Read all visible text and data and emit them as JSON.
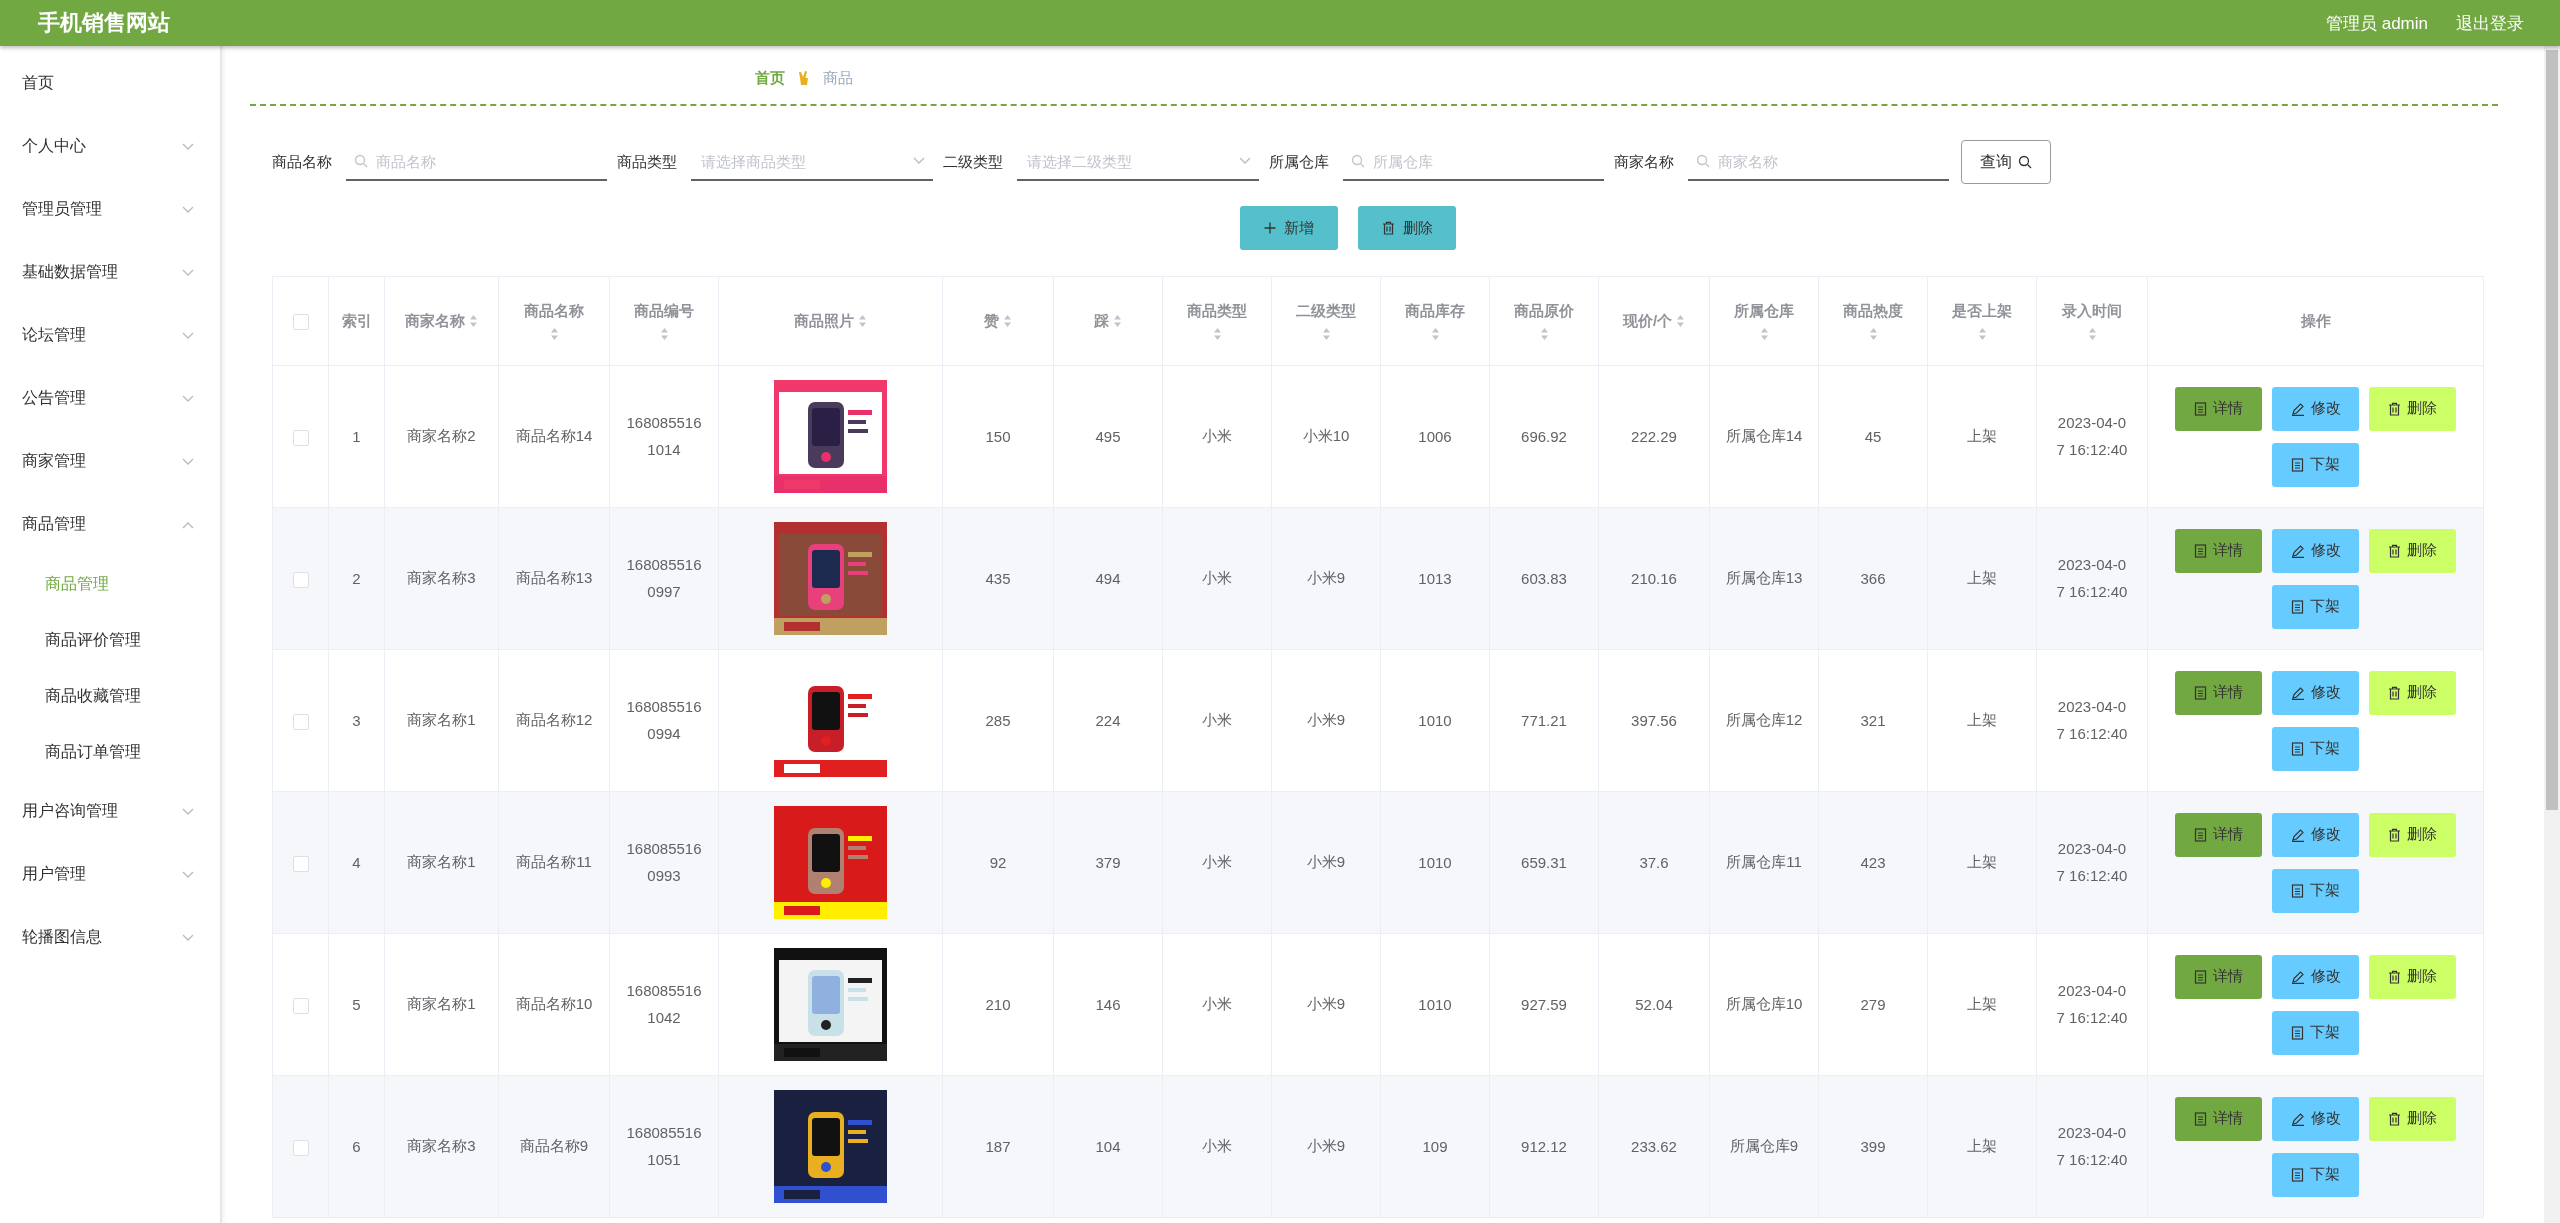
{
  "header": {
    "title": "手机销售网站",
    "user": "管理员 admin",
    "logout": "退出登录"
  },
  "sidebar": {
    "items": [
      {
        "label": "首页",
        "kind": "link"
      },
      {
        "label": "个人中心",
        "kind": "group",
        "expanded": false
      },
      {
        "label": "管理员管理",
        "kind": "group",
        "expanded": false
      },
      {
        "label": "基础数据管理",
        "kind": "group",
        "expanded": false
      },
      {
        "label": "论坛管理",
        "kind": "group",
        "expanded": false
      },
      {
        "label": "公告管理",
        "kind": "group",
        "expanded": false
      },
      {
        "label": "商家管理",
        "kind": "group",
        "expanded": false
      },
      {
        "label": "商品管理",
        "kind": "group",
        "expanded": true,
        "children": [
          {
            "label": "商品管理",
            "selected": true
          },
          {
            "label": "商品评价管理",
            "selected": false
          },
          {
            "label": "商品收藏管理",
            "selected": false
          },
          {
            "label": "商品订单管理",
            "selected": false
          }
        ]
      },
      {
        "label": "用户咨询管理",
        "kind": "group",
        "expanded": false
      },
      {
        "label": "用户管理",
        "kind": "group",
        "expanded": false
      },
      {
        "label": "轮播图信息",
        "kind": "group",
        "expanded": false
      }
    ]
  },
  "breadcrumb": [
    {
      "label": "首页",
      "selected": true
    },
    {
      "label": "商品",
      "selected": false
    }
  ],
  "search": {
    "fields": [
      {
        "label": "商品名称",
        "placeholder": "商品名称",
        "kind": "text"
      },
      {
        "label": "商品类型",
        "placeholder": "请选择商品类型",
        "kind": "select"
      },
      {
        "label": "二级类型",
        "placeholder": "请选择二级类型",
        "kind": "select"
      },
      {
        "label": "所属仓库",
        "placeholder": "所属仓库",
        "kind": "text"
      },
      {
        "label": "商家名称",
        "placeholder": "商家名称",
        "kind": "text"
      }
    ],
    "button": "查询"
  },
  "toolbar": [
    {
      "label": "新增",
      "kind": "add"
    },
    {
      "label": "删除",
      "kind": "delete"
    }
  ],
  "table": {
    "select_all": {
      "checked": false
    },
    "columns": [
      {
        "label": "索引",
        "kind": "plain"
      },
      {
        "label": "商家名称",
        "kind": "inline"
      },
      {
        "label": "商品名称",
        "kind": "stacked"
      },
      {
        "label": "商品编号",
        "kind": "stacked"
      },
      {
        "label": "商品照片",
        "kind": "inline"
      },
      {
        "label": "赞",
        "kind": "inline"
      },
      {
        "label": "踩",
        "kind": "inline"
      },
      {
        "label": "商品类型",
        "kind": "stacked"
      },
      {
        "label": "二级类型",
        "kind": "stacked"
      },
      {
        "label": "商品库存",
        "kind": "stacked"
      },
      {
        "label": "商品原价",
        "kind": "stacked"
      },
      {
        "label": "现价/个",
        "kind": "inline"
      },
      {
        "label": "所属仓库",
        "kind": "stacked"
      },
      {
        "label": "商品热度",
        "kind": "stacked"
      },
      {
        "label": "是否上架",
        "kind": "stacked"
      },
      {
        "label": "录入时间",
        "kind": "stacked"
      },
      {
        "label": "操作",
        "kind": "plain"
      }
    ],
    "rows": [
      {
        "checked": false,
        "cells": [
          "1",
          "商家名称2",
          "商品名称14",
          "1680855161014",
          {
            "kind": "picture"
          },
          "150",
          "495",
          "小米",
          "小米10",
          "1006",
          "696.92",
          "222.29",
          "所属仓库14",
          "45",
          "上架",
          "2023-04-07 16:12:40"
        ],
        "actions": [
          {
            "label": "详情",
            "kind": "detail"
          },
          {
            "label": "修改",
            "kind": "edit"
          },
          {
            "label": "删除",
            "kind": "delete"
          },
          {
            "label": "下架",
            "kind": "offshelf"
          }
        ]
      },
      {
        "checked": false,
        "cells": [
          "2",
          "商家名称3",
          "商品名称13",
          "1680855160997",
          {
            "kind": "picture"
          },
          "435",
          "494",
          "小米",
          "小米9",
          "1013",
          "603.83",
          "210.16",
          "所属仓库13",
          "366",
          "上架",
          "2023-04-07 16:12:40"
        ],
        "actions": [
          {
            "label": "详情",
            "kind": "detail"
          },
          {
            "label": "修改",
            "kind": "edit"
          },
          {
            "label": "删除",
            "kind": "delete"
          },
          {
            "label": "下架",
            "kind": "offshelf"
          }
        ]
      },
      {
        "checked": false,
        "cells": [
          "3",
          "商家名称1",
          "商品名称12",
          "1680855160994",
          {
            "kind": "picture"
          },
          "285",
          "224",
          "小米",
          "小米9",
          "1010",
          "771.21",
          "397.56",
          "所属仓库12",
          "321",
          "上架",
          "2023-04-07 16:12:40"
        ],
        "actions": [
          {
            "label": "详情",
            "kind": "detail"
          },
          {
            "label": "修改",
            "kind": "edit"
          },
          {
            "label": "删除",
            "kind": "delete"
          },
          {
            "label": "下架",
            "kind": "offshelf"
          }
        ]
      },
      {
        "checked": false,
        "cells": [
          "4",
          "商家名称1",
          "商品名称11",
          "1680855160993",
          {
            "kind": "picture"
          },
          "92",
          "379",
          "小米",
          "小米9",
          "1010",
          "659.31",
          "37.6",
          "所属仓库11",
          "423",
          "上架",
          "2023-04-07 16:12:40"
        ],
        "actions": [
          {
            "label": "详情",
            "kind": "detail"
          },
          {
            "label": "修改",
            "kind": "edit"
          },
          {
            "label": "删除",
            "kind": "delete"
          },
          {
            "label": "下架",
            "kind": "offshelf"
          }
        ]
      },
      {
        "checked": false,
        "cells": [
          "5",
          "商家名称1",
          "商品名称10",
          "1680855161042",
          {
            "kind": "picture"
          },
          "210",
          "146",
          "小米",
          "小米9",
          "1010",
          "927.59",
          "52.04",
          "所属仓库10",
          "279",
          "上架",
          "2023-04-07 16:12:40"
        ],
        "actions": [
          {
            "label": "详情",
            "kind": "detail"
          },
          {
            "label": "修改",
            "kind": "edit"
          },
          {
            "label": "删除",
            "kind": "delete"
          },
          {
            "label": "下架",
            "kind": "offshelf"
          }
        ]
      },
      {
        "checked": false,
        "cells": [
          "6",
          "商家名称3",
          "商品名称9",
          "1680855161051",
          {
            "kind": "picture"
          },
          "187",
          "104",
          "小米",
          "小米9",
          "109",
          "912.12",
          "233.62",
          "所属仓库9",
          "399",
          "上架",
          "2023-04-07 16:12:40"
        ],
        "actions": [
          {
            "label": "详情",
            "kind": "detail"
          },
          {
            "label": "修改",
            "kind": "edit"
          },
          {
            "label": "删除",
            "kind": "delete"
          },
          {
            "label": "下架",
            "kind": "offshelf"
          }
        ]
      }
    ]
  }
}
